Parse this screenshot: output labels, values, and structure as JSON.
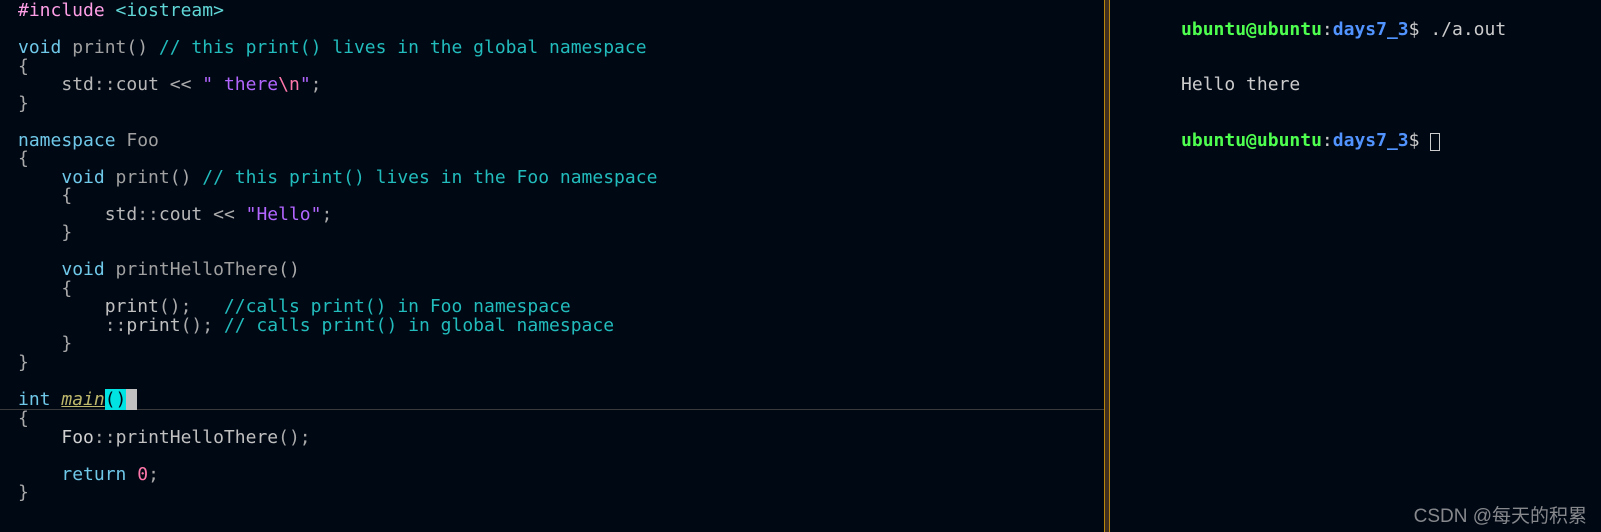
{
  "editor": {
    "lines": [
      {
        "g": "",
        "segments": [
          [
            "pp",
            "#include "
          ],
          [
            "inc",
            "<iostream>"
          ]
        ]
      },
      {
        "g": "",
        "segments": []
      },
      {
        "g": "",
        "segments": [
          [
            "kw",
            "void "
          ],
          [
            "fn",
            "print"
          ],
          [
            "op",
            "() "
          ],
          [
            "cmt",
            "// this print() lives in the global namespace"
          ]
        ]
      },
      {
        "g": "",
        "segments": [
          [
            "op",
            "{"
          ]
        ]
      },
      {
        "g": "",
        "segments": [
          [
            "op",
            "    "
          ],
          [
            "ns",
            "std"
          ],
          [
            "op",
            "::"
          ],
          [
            "ns",
            "cout"
          ],
          [
            "op",
            " << "
          ],
          [
            "str",
            "\" there"
          ],
          [
            "esc",
            "\\n"
          ],
          [
            "str",
            "\""
          ],
          [
            "op",
            ";"
          ]
        ]
      },
      {
        "g": "",
        "segments": [
          [
            "op",
            "}"
          ]
        ]
      },
      {
        "g": "",
        "segments": []
      },
      {
        "g": "",
        "segments": [
          [
            "kw",
            "namespace "
          ],
          [
            "fn",
            "Foo"
          ]
        ]
      },
      {
        "g": "",
        "segments": [
          [
            "op",
            "{"
          ]
        ]
      },
      {
        "g": "",
        "segments": [
          [
            "op",
            "    "
          ],
          [
            "kw",
            "void "
          ],
          [
            "fn",
            "print"
          ],
          [
            "op",
            "() "
          ],
          [
            "cmt",
            "// this print() lives in the Foo namespace"
          ]
        ]
      },
      {
        "g": "",
        "segments": [
          [
            "op",
            "    {"
          ]
        ]
      },
      {
        "g": "",
        "segments": [
          [
            "op",
            "        "
          ],
          [
            "ns",
            "std"
          ],
          [
            "op",
            "::"
          ],
          [
            "ns",
            "cout"
          ],
          [
            "op",
            " << "
          ],
          [
            "str",
            "\"Hello\""
          ],
          [
            "op",
            ";"
          ]
        ]
      },
      {
        "g": "",
        "segments": [
          [
            "op",
            "    }"
          ]
        ]
      },
      {
        "g": "",
        "segments": []
      },
      {
        "g": "",
        "segments": [
          [
            "op",
            "    "
          ],
          [
            "kw",
            "void "
          ],
          [
            "fn",
            "printHelloThere"
          ],
          [
            "op",
            "()"
          ]
        ]
      },
      {
        "g": "",
        "segments": [
          [
            "op",
            "    {"
          ]
        ]
      },
      {
        "g": "",
        "segments": [
          [
            "op",
            "        "
          ],
          [
            "call",
            "print"
          ],
          [
            "op",
            "();   "
          ],
          [
            "cmt",
            "//calls print() in Foo namespace"
          ]
        ]
      },
      {
        "g": "",
        "segments": [
          [
            "op",
            "        ::"
          ],
          [
            "call",
            "print"
          ],
          [
            "op",
            "(); "
          ],
          [
            "cmt",
            "// calls print() in global namespace"
          ]
        ]
      },
      {
        "g": "",
        "segments": [
          [
            "op",
            "    }"
          ]
        ]
      },
      {
        "g": "",
        "segments": [
          [
            "op",
            "}"
          ]
        ]
      },
      {
        "g": "",
        "segments": []
      },
      {
        "g": "",
        "type": "mainline",
        "text_int": "int ",
        "text_main": "main",
        "cl": "underline-row"
      },
      {
        "g": "",
        "segments": [
          [
            "op",
            "{"
          ]
        ]
      },
      {
        "g": "",
        "segments": [
          [
            "op",
            "    "
          ],
          [
            "fooc",
            "Foo"
          ],
          [
            "op",
            "::"
          ],
          [
            "call",
            "printHelloThere"
          ],
          [
            "op",
            "();"
          ]
        ]
      },
      {
        "g": "",
        "segments": []
      },
      {
        "g": "",
        "segments": [
          [
            "op",
            "    "
          ],
          [
            "kw",
            "return "
          ],
          [
            "num",
            "0"
          ],
          [
            "op",
            ";"
          ]
        ]
      },
      {
        "g": "",
        "segments": [
          [
            "op",
            "}"
          ]
        ]
      }
    ]
  },
  "terminal": {
    "prompt_user": "ubuntu@ubuntu",
    "prompt_colon": ":",
    "prompt_path": "days7_3",
    "prompt_dollar": "$",
    "cmd1": "./a.out",
    "out1": "Hello there"
  },
  "watermark": "CSDN @每天的积累"
}
